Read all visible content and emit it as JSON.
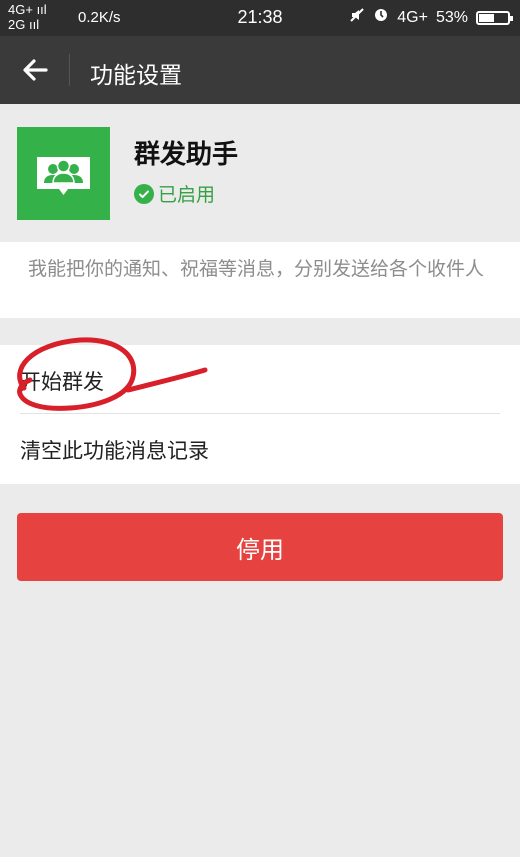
{
  "status_bar": {
    "network_top": "4G+",
    "network_bottom": "2G",
    "speed": "0.2K/s",
    "time": "21:38",
    "network_right": "4G+",
    "battery": "53%",
    "battery_level": 0.53
  },
  "header": {
    "title": "功能设置"
  },
  "app": {
    "name": "群发助手",
    "status": "已启用"
  },
  "description": "我能把你的通知、祝福等消息，分别发送给各个收件人",
  "actions": [
    {
      "label": "开始群发"
    },
    {
      "label": "清空此功能消息记录"
    }
  ],
  "disable_label": "停用",
  "colors": {
    "accent_green": "#35b14a",
    "danger_red": "#e64340",
    "annotation_red": "#d8202a"
  }
}
